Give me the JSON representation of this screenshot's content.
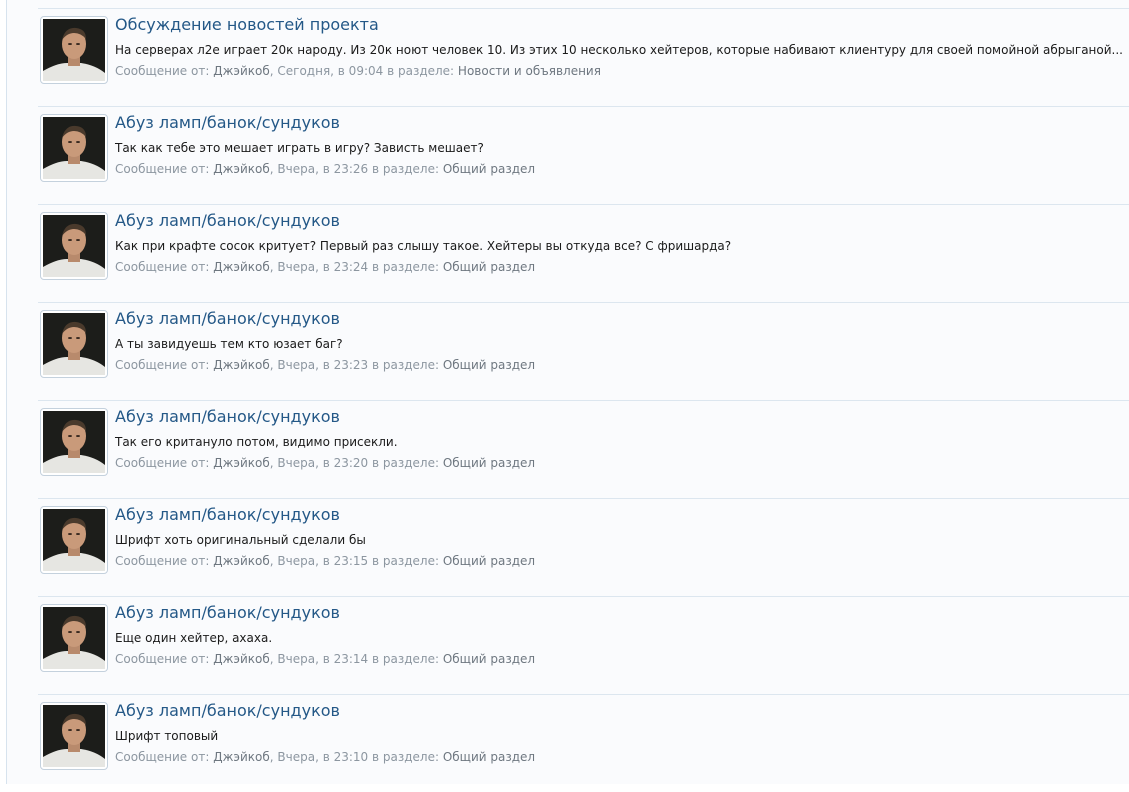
{
  "results": [
    {
      "title": "Обсуждение новостей проекта",
      "snippet": "На серверах л2е играет 20к народу. Из 20к ноют человек 10. Из этих 10 несколько хейтеров, которые набивают клиентуру для своей помойной абрыганой...",
      "meta_prefix": "Сообщение от:",
      "author": "Джэйкоб",
      "date": ", Сегодня, в 09:04",
      "meta_section_prefix": " в разделе:",
      "section": "Новости и объявления"
    },
    {
      "title": "Абуз ламп/банок/сундуков",
      "snippet": "Так как тебе это мешает играть в игру? Зависть мешает?",
      "meta_prefix": "Сообщение от:",
      "author": "Джэйкоб",
      "date": ", Вчера, в 23:26",
      "meta_section_prefix": " в разделе:",
      "section": "Общий раздел"
    },
    {
      "title": "Абуз ламп/банок/сундуков",
      "snippet": "Как при крафте сосок критует? Первый раз слышу такое. Хейтеры вы откуда все? С фришарда?",
      "meta_prefix": "Сообщение от:",
      "author": "Джэйкоб",
      "date": ", Вчера, в 23:24",
      "meta_section_prefix": " в разделе:",
      "section": "Общий раздел"
    },
    {
      "title": "Абуз ламп/банок/сундуков",
      "snippet": "А ты завидуешь тем кто юзает баг?",
      "meta_prefix": "Сообщение от:",
      "author": "Джэйкоб",
      "date": ", Вчера, в 23:23",
      "meta_section_prefix": " в разделе:",
      "section": "Общий раздел"
    },
    {
      "title": "Абуз ламп/банок/сундуков",
      "snippet": "Так его критануло потом, видимо присекли.",
      "meta_prefix": "Сообщение от:",
      "author": "Джэйкоб",
      "date": ", Вчера, в 23:20",
      "meta_section_prefix": " в разделе:",
      "section": "Общий раздел"
    },
    {
      "title": "Абуз ламп/банок/сундуков",
      "snippet": "Шрифт хоть оригинальный сделали бы",
      "meta_prefix": "Сообщение от:",
      "author": "Джэйкоб",
      "date": ", Вчера, в 23:15",
      "meta_section_prefix": " в разделе:",
      "section": "Общий раздел"
    },
    {
      "title": "Абуз ламп/банок/сундуков",
      "snippet": "Еще один хейтер, ахаха.",
      "meta_prefix": "Сообщение от:",
      "author": "Джэйкоб",
      "date": ", Вчера, в 23:14",
      "meta_section_prefix": " в разделе:",
      "section": "Общий раздел"
    },
    {
      "title": "Абуз ламп/банок/сундуков",
      "snippet": "Шрифт топовый",
      "meta_prefix": "Сообщение от:",
      "author": "Джэйкоб",
      "date": ", Вчера, в 23:10",
      "meta_section_prefix": " в разделе:",
      "section": "Общий раздел"
    }
  ]
}
